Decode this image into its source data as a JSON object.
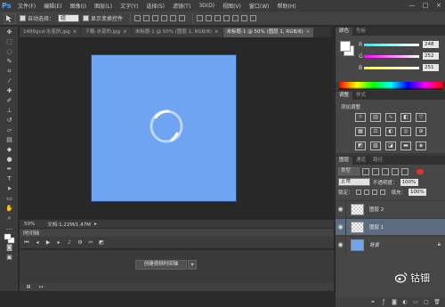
{
  "app": {
    "logo": "Ps",
    "menus": [
      "文件(F)",
      "编辑(E)",
      "图像(I)",
      "图层(L)",
      "文字(Y)",
      "选择(S)",
      "滤镜(T)",
      "3D(D)",
      "视图(V)",
      "窗口(W)",
      "帮助(H)"
    ],
    "window_controls": [
      "—",
      "□",
      "×"
    ]
  },
  "options": {
    "auto_select_label": "自动选择：",
    "auto_select_value": "组",
    "show_transform_label": "显示变换控件"
  },
  "tabs": [
    {
      "label": "1486gcd-水变的.jpg",
      "active": false
    },
    {
      "label": "下载-水变的.jpg",
      "active": false
    },
    {
      "label": "未标题-1 @ 50% (图层 1, RGB/8)",
      "active": false
    },
    {
      "label": "未标题-1 @ 50% (图层 1, RGB/8)",
      "active": true
    }
  ],
  "status": {
    "zoom": "50%",
    "doc": "文档:1.22M/1.47M"
  },
  "timeline": {
    "title": "时间轴",
    "create_button": "创建视频时间轴"
  },
  "color_panel": {
    "tabs": [
      "颜色",
      "色板"
    ],
    "channels": [
      {
        "name": "R",
        "value": "248",
        "color": "#ff4040"
      },
      {
        "name": "G",
        "value": "252",
        "color": "#40ff40"
      },
      {
        "name": "B",
        "value": "251",
        "color": "#4060ff"
      }
    ]
  },
  "adjustments_panel": {
    "tabs": [
      "调整",
      "样式"
    ],
    "label": "添加调整"
  },
  "layers_panel": {
    "tabs": [
      "图层",
      "通道",
      "路径"
    ],
    "kind": "类型",
    "blend_mode": "正常",
    "opacity_label": "不透明度：",
    "opacity_value": "100%",
    "lock_label": "锁定：",
    "fill_label": "填充：",
    "fill_value": "100%",
    "layers": [
      {
        "name": "图层 2",
        "thumb": "checker",
        "active": false
      },
      {
        "name": "图层 1",
        "thumb": "checker",
        "active": true
      },
      {
        "name": "背景",
        "thumb": "blue",
        "active": false
      }
    ]
  },
  "watermark": {
    "text": "钴钿"
  }
}
